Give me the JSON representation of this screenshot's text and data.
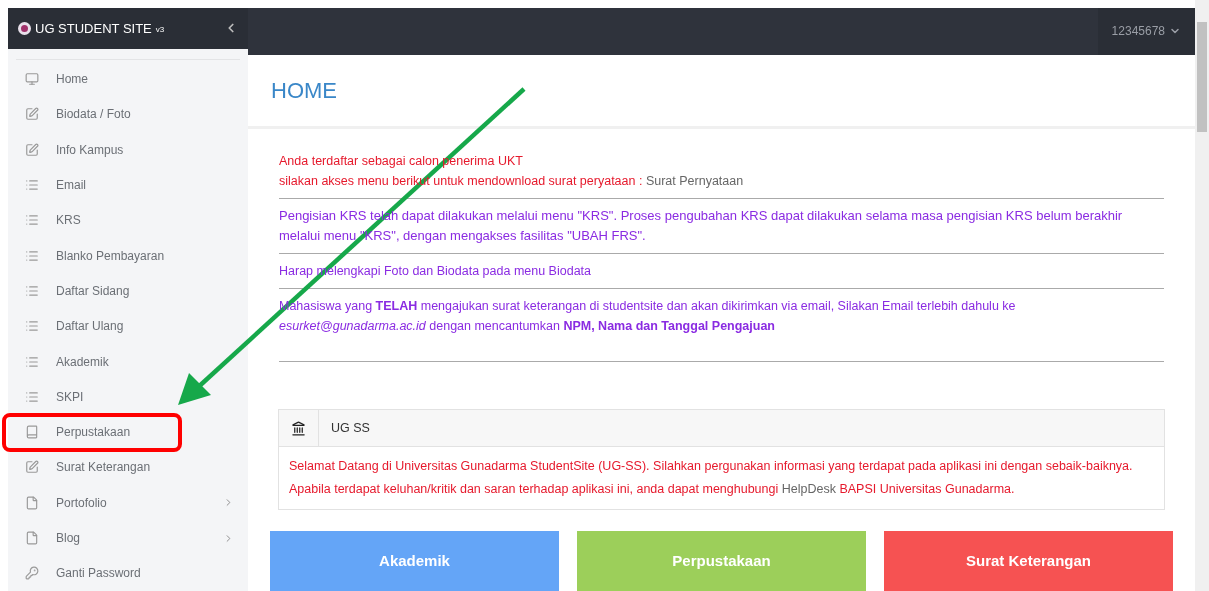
{
  "brand": {
    "title": "UG STUDENT SITE",
    "version": "v3"
  },
  "user": {
    "id": "12345678"
  },
  "sidebar": {
    "items": [
      {
        "label": "Home",
        "submenu": false,
        "highlighted": false
      },
      {
        "label": "Biodata / Foto",
        "submenu": false,
        "highlighted": false
      },
      {
        "label": "Info Kampus",
        "submenu": false,
        "highlighted": false
      },
      {
        "label": "Email",
        "submenu": false,
        "highlighted": false
      },
      {
        "label": "KRS",
        "submenu": false,
        "highlighted": false
      },
      {
        "label": "Blanko Pembayaran",
        "submenu": false,
        "highlighted": false
      },
      {
        "label": "Daftar Sidang",
        "submenu": false,
        "highlighted": false
      },
      {
        "label": "Daftar Ulang",
        "submenu": false,
        "highlighted": false
      },
      {
        "label": "Akademik",
        "submenu": false,
        "highlighted": false
      },
      {
        "label": "SKPI",
        "submenu": false,
        "highlighted": false
      },
      {
        "label": "Perpustakaan",
        "submenu": false,
        "highlighted": true
      },
      {
        "label": "Surat Keterangan",
        "submenu": false,
        "highlighted": false
      },
      {
        "label": "Portofolio",
        "submenu": true,
        "highlighted": false
      },
      {
        "label": "Blog",
        "submenu": true,
        "highlighted": false
      },
      {
        "label": "Ganti Password",
        "submenu": false,
        "highlighted": false
      }
    ]
  },
  "page_title": "HOME",
  "notices": {
    "ukt_line1": "Anda terdaftar sebagai calon penerima UKT",
    "ukt_line2": "silakan akses menu berikut untuk mendownload surat peryataan :",
    "ukt_link": "Surat Pernyataan",
    "krs": "Pengisian KRS telah dapat dilakukan melalui menu \"KRS\". Proses pengubahan KRS dapat dilakukan selama masa pengisian KRS belum berakhir melalui menu \"KRS\", dengan mengakses fasilitas \"UBAH FRS\".",
    "biodata": "Harap melengkapi Foto dan Biodata pada menu Biodata",
    "surket": "Mahasiswa yang **TELAH** mengajukan surat keterangan di studentsite dan akan dikirimkan via email, Silakan Email terlebih dahulu ke *esurket@gunadarma.ac.id* dengan mencantumkan **NPM, Nama dan Tanggal Pengajuan**"
  },
  "panel": {
    "title": "UG SS",
    "welcome": "Selamat Datang di Universitas Gunadarma StudentSite (UG-SS). Silahkan pergunakan informasi yang terdapat pada aplikasi ini dengan sebaik-baiknya.",
    "contact_before": "Apabila terdapat keluhan/kritik dan saran terhadap aplikasi ini, anda dapat menghubungi",
    "contact_link": "HelpDesk",
    "contact_after": "BAPSI Universitas Gunadarma."
  },
  "tiles": [
    {
      "label": "Akademik",
      "color": "#64a5f7"
    },
    {
      "label": "Perpustakaan",
      "color": "#9ccf5a"
    },
    {
      "label": "Surat Keterangan",
      "color": "#f65252"
    }
  ]
}
